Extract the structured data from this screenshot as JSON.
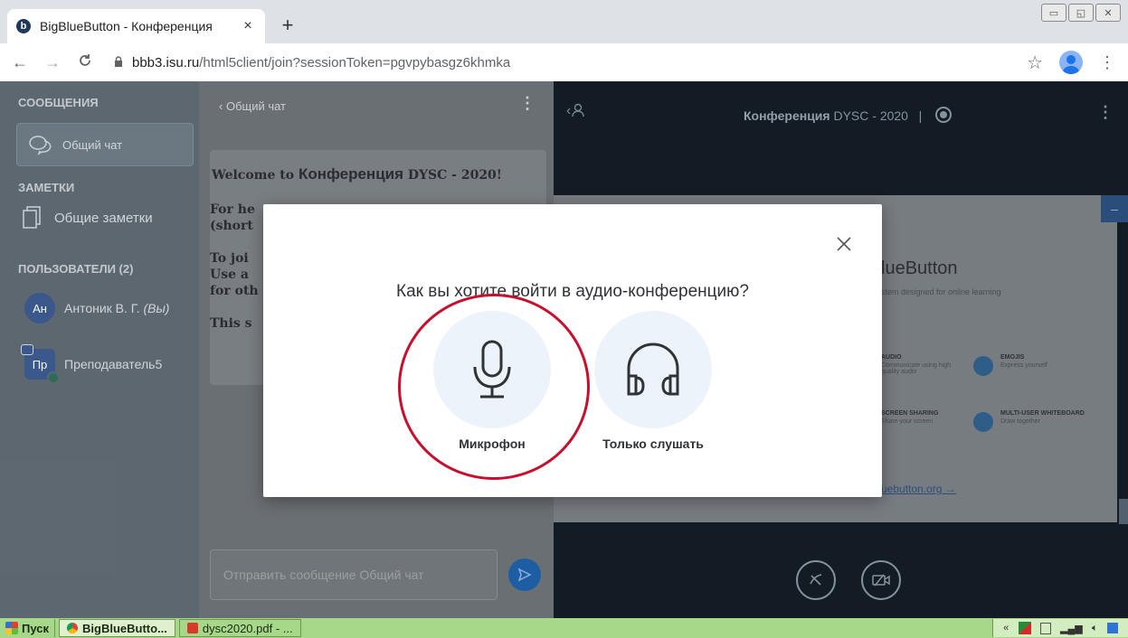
{
  "browser": {
    "tab_title": "BigBlueButton - Конференция",
    "tab_close": "×",
    "new_tab": "+",
    "url_host": "bbb3.isu.ru",
    "url_path": "/html5client/join?sessionToken=pgvpybasgz6khmka",
    "window_controls": [
      "▭",
      "◱",
      "✕"
    ]
  },
  "sidebar": {
    "messages_title": "СООБЩЕНИЯ",
    "public_chat": "Общий чат",
    "notes_title": "ЗАМЕТКИ",
    "shared_notes": "Общие заметки",
    "users_title": "ПОЛЬЗОВАТЕЛИ (2)",
    "users": [
      {
        "initials": "Ан",
        "name": "Антоник В. Г.",
        "suffix": "(Вы)"
      },
      {
        "initials": "Пр",
        "name": "Преподаватель5",
        "suffix": ""
      }
    ]
  },
  "chat": {
    "header": "Общий чат",
    "welcome_line1_a": "Welcome to ",
    "welcome_line1_b": "Конференция",
    "welcome_line1_c": " DYSC - 2020!",
    "line_for_he": "For he",
    "line_short": "(short",
    "line_to_join": "To joi",
    "line_use_a": "Use a",
    "line_for_oth": "for oth",
    "line_this": "This s",
    "input_placeholder": "Отправить сообщение Общий чат"
  },
  "presentation": {
    "title_bold": "Конференция",
    "title_rest": " DYSC - 2020",
    "divider": "|",
    "slide_minimize": "–",
    "slide_title": "lueButton",
    "slide_subtitle": "stem designed for online learning",
    "features": [
      {
        "name": "AUDIO",
        "desc": "Communicate using high quality audio"
      },
      {
        "name": "EMOJIS",
        "desc": "Express yourself"
      },
      {
        "name": "SCREEN SHARING",
        "desc": "Share your screen"
      },
      {
        "name": "MULTI-USER WHITEBOARD",
        "desc": "Draw together"
      }
    ],
    "slide_link": "uebutton.org →"
  },
  "modal": {
    "title": "Как вы хотите войти в аудио-конференцию?",
    "option_mic": "Микрофон",
    "option_listen": "Только слушать"
  },
  "taskbar": {
    "start": "Пуск",
    "task_browser": "BigBlueButto...",
    "task_pdf": "dysc2020.pdf - ...",
    "tray_arrow": "«"
  },
  "colors": {
    "accent": "#1e5fa8",
    "annotation_red": "#c8102e",
    "taskbar_green": "#a7d788"
  }
}
